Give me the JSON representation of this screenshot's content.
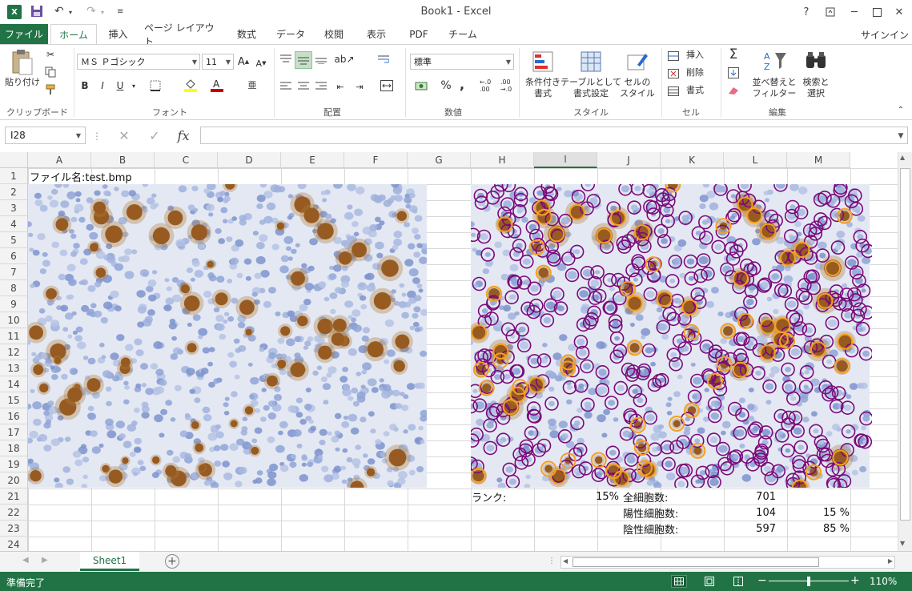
{
  "window": {
    "title": "Book1 - Excel",
    "app_icon_letter": "X",
    "help_label": "?",
    "signin_label": "サインイン"
  },
  "tabs": [
    {
      "label": "ファイル"
    },
    {
      "label": "ホーム"
    },
    {
      "label": "挿入"
    },
    {
      "label": "ページ レイアウト"
    },
    {
      "label": "数式"
    },
    {
      "label": "データ"
    },
    {
      "label": "校閲"
    },
    {
      "label": "表示"
    },
    {
      "label": "PDF"
    },
    {
      "label": "チーム"
    }
  ],
  "ribbon": {
    "clipboard": {
      "paste_label": "貼り付け",
      "group_label": "クリップボード"
    },
    "font": {
      "font_name": "ＭＳ Ｐゴシック",
      "font_size": "11",
      "group_label": "フォント",
      "bold": "B",
      "italic": "I",
      "underline": "U"
    },
    "alignment": {
      "group_label": "配置"
    },
    "number": {
      "format": "標準",
      "group_label": "数値",
      "percent": "%",
      "comma": ","
    },
    "styles": {
      "conditional_label": "条件付き\n書式",
      "table_label": "テーブルとして\n書式設定",
      "cell_style_label": "セルの\nスタイル",
      "group_label": "スタイル"
    },
    "cells": {
      "insert_label": "挿入",
      "delete_label": "削除",
      "format_label": "書式",
      "group_label": "セル"
    },
    "editing": {
      "sort_label": "並べ替えと\nフィルター",
      "find_label": "検索と\n選択",
      "group_label": "編集"
    }
  },
  "formula_bar": {
    "name_box": "I28",
    "fx_label": "fx",
    "value": ""
  },
  "columns": [
    "A",
    "B",
    "C",
    "D",
    "E",
    "F",
    "G",
    "H",
    "I",
    "J",
    "K",
    "L",
    "M"
  ],
  "selected_column": "I",
  "rows": [
    "1",
    "2",
    "3",
    "4",
    "5",
    "6",
    "7",
    "8",
    "9",
    "10",
    "11",
    "12",
    "13",
    "14",
    "15",
    "16",
    "17",
    "18",
    "19",
    "20",
    "21",
    "22",
    "23",
    "24"
  ],
  "cells": {
    "a1": "ファイル名:test.bmp",
    "h21": "ランク:",
    "i21": "15%",
    "j21": "全細胞数:",
    "k21": "701",
    "j22": "陽性細胞数:",
    "k22": "104",
    "l22": "15 %",
    "j23": "陰性細胞数:",
    "k23": "597",
    "l23": "85 %"
  },
  "sheet": {
    "tab_label": "Sheet1",
    "add_label": "+"
  },
  "status": {
    "ready_label": "準備完了",
    "zoom": "110%"
  },
  "colors": {
    "accent": "#217346",
    "stain_brown": "#8a4a14",
    "stain_blue": "#9fb0da",
    "negative_marker": "#7a0a7a",
    "positive_marker": "#f5a020"
  }
}
